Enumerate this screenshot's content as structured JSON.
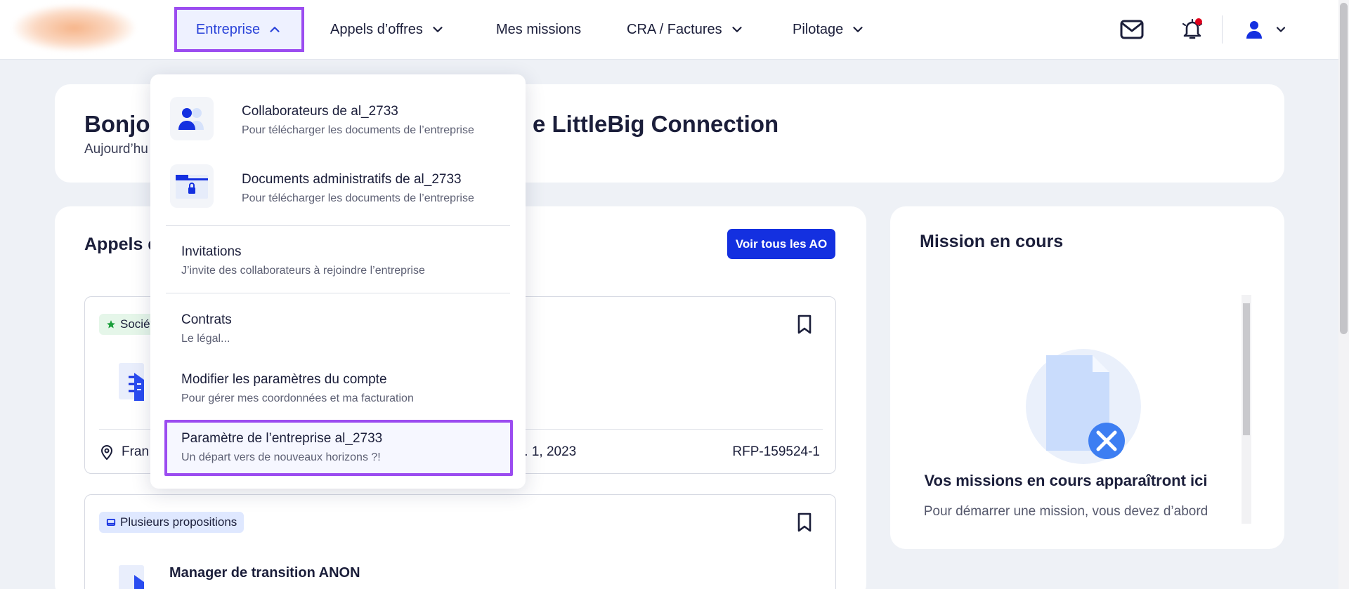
{
  "nav": {
    "items": [
      {
        "label": "Entreprise"
      },
      {
        "label": "Appels d’offres"
      },
      {
        "label": "Mes missions"
      },
      {
        "label": "CRA / Factures"
      },
      {
        "label": "Pilotage"
      }
    ]
  },
  "greeting": {
    "title_start": "Bonjou",
    "title_end": "e LittleBig Connection",
    "subtitle": "Aujourd’hu"
  },
  "tenders": {
    "title": "Appels d",
    "view_all": "Voir tous les AO",
    "items": [
      {
        "tag": "Sociét",
        "location": "Fran",
        "date": "r. 1, 2023",
        "ref": "RFP-159524-1"
      },
      {
        "tag": "Plusieurs propositions",
        "title": "Manager de transition ANON"
      }
    ]
  },
  "mission": {
    "title": "Mission en cours",
    "empty_title": "Vos missions en cours apparaîtront ici",
    "empty_sub": "Pour démarrer une mission, vous devez d’abord"
  },
  "dropdown": {
    "items": [
      {
        "title": "Collaborateurs de al_2733",
        "sub": "Pour télécharger les documents de l’entreprise"
      },
      {
        "title": "Documents administratifs de al_2733",
        "sub": "Pour télécharger les documents de l’entreprise"
      },
      {
        "title": "Invitations",
        "sub": "J’invite des collaborateurs à rejoindre l’entreprise"
      },
      {
        "title": "Contrats",
        "sub": "Le légal..."
      },
      {
        "title": "Modifier les paramètres du compte",
        "sub": "Pour gérer mes coordonnées et ma facturation"
      },
      {
        "title": "Paramètre de l’entreprise al_2733",
        "sub": "Un départ vers de nouveaux horizons ?!"
      }
    ]
  },
  "colors": {
    "accent": "#1430e0",
    "highlight_border": "#9b4cf0",
    "notification_dot": "#e0001b"
  }
}
